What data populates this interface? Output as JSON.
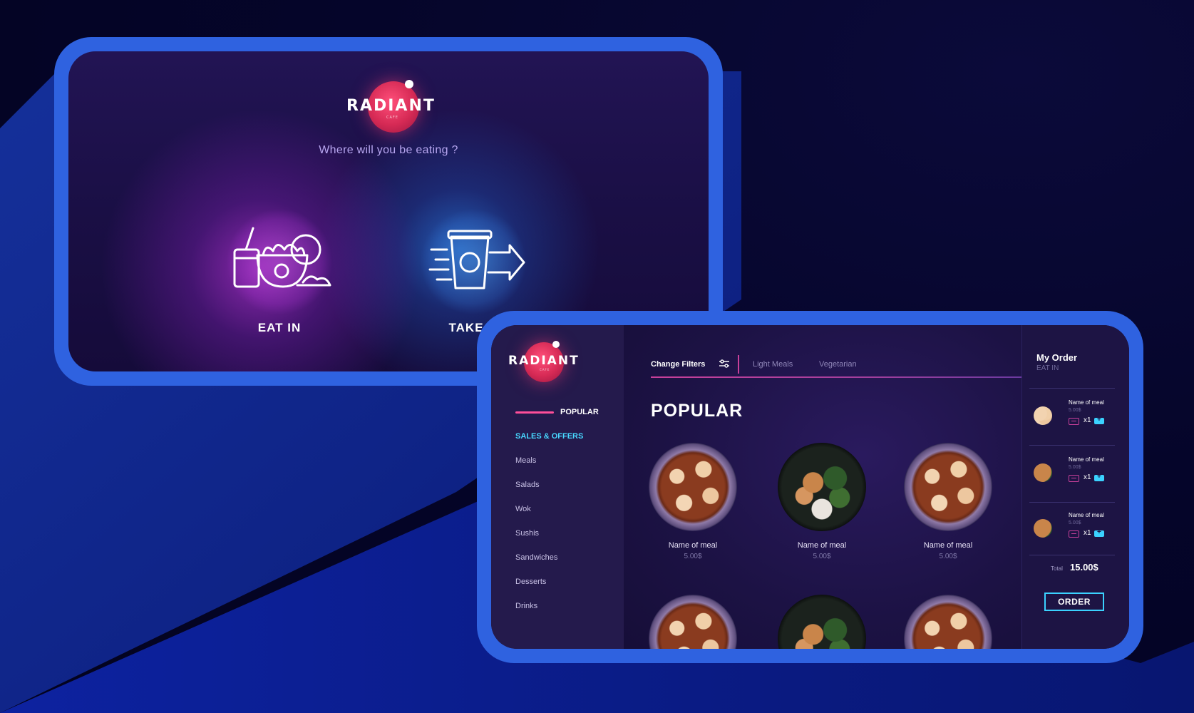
{
  "brand": {
    "name": "RADIANT",
    "sub": "CAFE"
  },
  "welcome": {
    "question": "Where will you be eating ?",
    "options": [
      {
        "label": "EAT IN",
        "icon": "noodle-bowl-icon"
      },
      {
        "label": "TAKE O",
        "icon": "takeaway-cup-icon"
      }
    ]
  },
  "sidebar": {
    "items": [
      {
        "label": "POPULAR",
        "active": true
      },
      {
        "label": "SALES & OFFERS",
        "highlight": true
      },
      {
        "label": "Meals"
      },
      {
        "label": "Salads"
      },
      {
        "label": "Wok"
      },
      {
        "label": "Sushis"
      },
      {
        "label": "Sandwiches"
      },
      {
        "label": "Desserts"
      },
      {
        "label": "Drinks"
      }
    ]
  },
  "filters": {
    "change_label": "Change Filters",
    "chips": [
      "Light Meals",
      "Vegetarian"
    ]
  },
  "main": {
    "section_title": "POPULAR",
    "meals": [
      {
        "name": "Name of meal",
        "price": "5.00$",
        "image": "dumpling-soup"
      },
      {
        "name": "Name of meal",
        "price": "5.00$",
        "image": "chicken-salad"
      },
      {
        "name": "Name of meal",
        "price": "5.00$",
        "image": "dumpling-soup"
      }
    ]
  },
  "order": {
    "title": "My Order",
    "mode": "EAT IN",
    "items": [
      {
        "name": "Name of meal",
        "price": "5.00$",
        "qty": "x1"
      },
      {
        "name": "Name of meal",
        "price": "5.00$",
        "qty": "x1"
      },
      {
        "name": "Name of meal",
        "price": "5.00$",
        "qty": "x1"
      }
    ],
    "total_label": "Total",
    "total_value": "15.00$",
    "order_button": "ORDER"
  },
  "colors": {
    "frame": "#2f62e0",
    "accent_pink": "#ff4f9a",
    "accent_cyan": "#3bd2ff",
    "logo_red": "#d62a55"
  }
}
